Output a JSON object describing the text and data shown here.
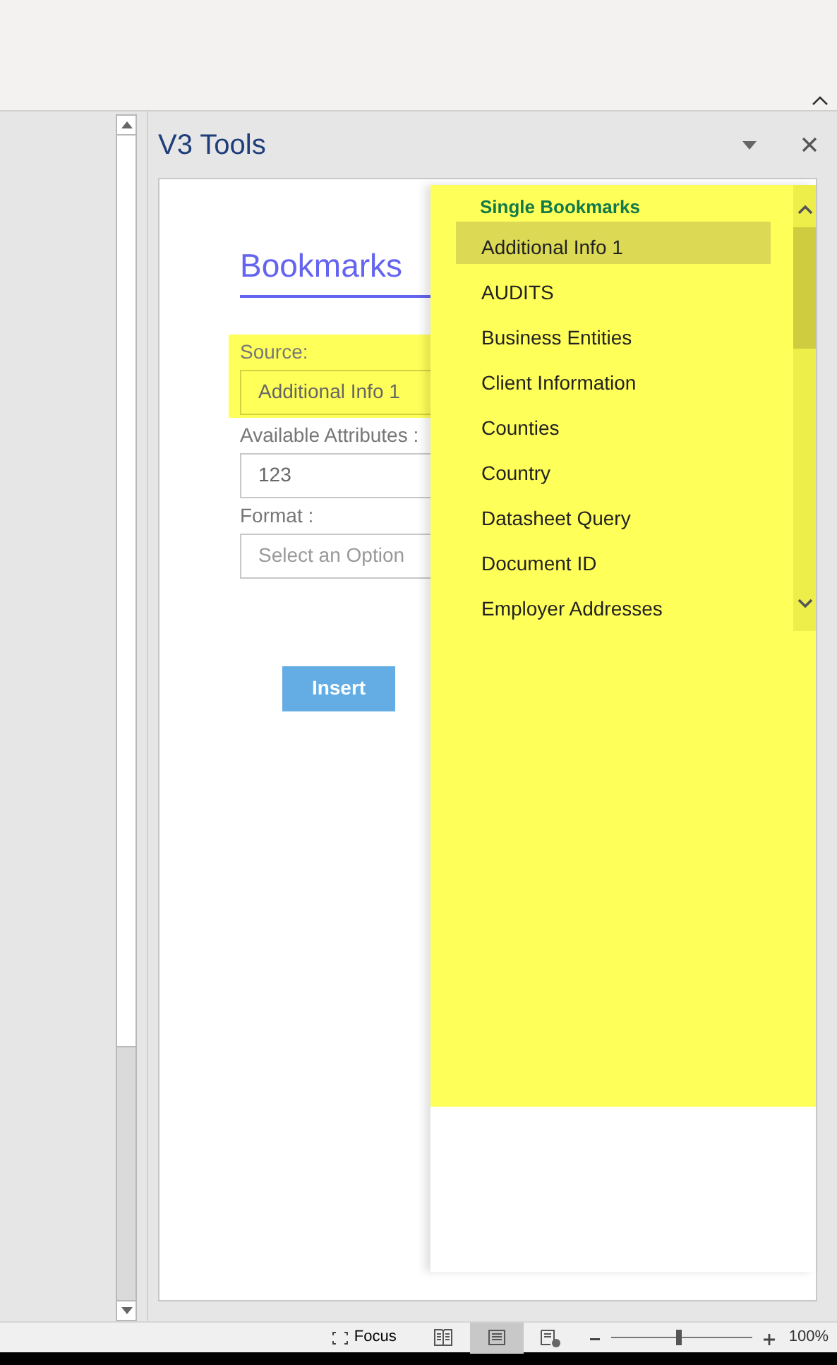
{
  "pane": {
    "title": "V3 Tools"
  },
  "form": {
    "heading": "Bookmarks",
    "fields": [
      {
        "label": "Source:",
        "value": "Additional Info 1",
        "focused": true
      },
      {
        "label": "Available Attributes :",
        "value": "123",
        "focused": false
      },
      {
        "label": "Format :",
        "placeholder": "Select an Option",
        "focused": false
      }
    ],
    "insert_button": "Insert"
  },
  "dropdown": {
    "group": "Single Bookmarks",
    "items": [
      {
        "label": "Additional Info 1",
        "selected": true
      },
      {
        "label": "AUDITS",
        "selected": false
      },
      {
        "label": "Business Entities",
        "selected": false
      },
      {
        "label": "Client Information",
        "selected": false
      },
      {
        "label": "Counties",
        "selected": false
      },
      {
        "label": "Country",
        "selected": false
      },
      {
        "label": "Datasheet Query",
        "selected": false
      },
      {
        "label": "Document ID",
        "selected": false
      },
      {
        "label": "Employer Addresses",
        "selected": false
      }
    ]
  },
  "status_bar": {
    "focus": "Focus",
    "views": [
      {
        "kind": "read",
        "selected": false
      },
      {
        "kind": "print",
        "selected": true
      },
      {
        "kind": "web",
        "selected": false
      }
    ],
    "zoom": {
      "level": 0.48,
      "reading": "100%"
    }
  }
}
